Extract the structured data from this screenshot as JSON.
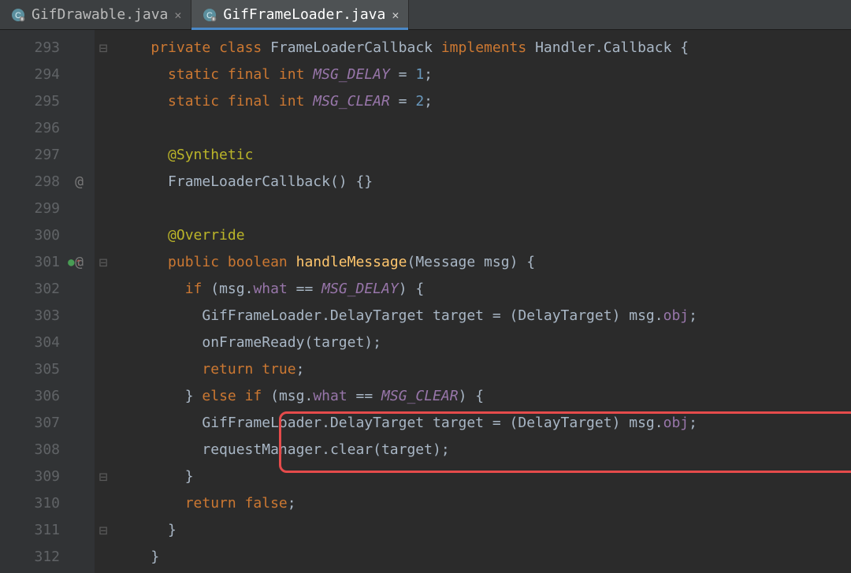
{
  "tabs": [
    {
      "label": "GifDrawable.java",
      "active": false
    },
    {
      "label": "GifFrameLoader.java",
      "active": true
    }
  ],
  "gutter": {
    "start": 293,
    "end": 312,
    "atMarks": {
      "298": "@",
      "301": "@"
    },
    "overrideMark": {
      "line": 301,
      "glyph": "O↑"
    }
  },
  "code": {
    "l293": {
      "kw_private": "private",
      "kw_class": "class",
      "class_name": "FrameLoaderCallback",
      "kw_implements": "implements",
      "iface": "Handler.Callback",
      "brace": " {"
    },
    "l294": {
      "kw": "static final int ",
      "name": "MSG_DELAY",
      "rest": " = ",
      "num": "1",
      "semi": ";"
    },
    "l295": {
      "kw": "static final int ",
      "name": "MSG_CLEAR",
      "rest": " = ",
      "num": "2",
      "semi": ";"
    },
    "l297": {
      "ann": "@Synthetic"
    },
    "l298": {
      "ctor": "FrameLoaderCallback",
      "rest": "() {}"
    },
    "l300": {
      "ann": "@Override"
    },
    "l301": {
      "kw_public": "public",
      "kw_boolean": "boolean",
      "method": "handleMessage",
      "params_open": "(",
      "param_type": "Message",
      "param_name": " msg",
      "params_close_brace": ") {"
    },
    "l302": {
      "kw_if": "if",
      "open": " (",
      "var": "msg",
      "dot": ".",
      "field": "what",
      "eq": " == ",
      "constref": "MSG_DELAY",
      "close": ") {"
    },
    "l303": {
      "type": "GifFrameLoader.DelayTarget",
      "var": " target = (",
      "cast": "DelayTarget",
      "rest": ") msg.",
      "field": "obj",
      "semi": ";"
    },
    "l304": {
      "call": "onFrameReady",
      "args": "(target);"
    },
    "l305": {
      "kw_return": "return",
      "kw_true": " true",
      "semi": ";"
    },
    "l306": {
      "close": "} ",
      "kw_else": "else",
      "kw_if": " if",
      "open": " (",
      "var": "msg",
      "dot": ".",
      "field": "what",
      "eq": " == ",
      "constref": "MSG_CLEAR",
      "close2": ") {"
    },
    "l307": {
      "type": "GifFrameLoader.DelayTarget",
      "var": " target = (",
      "cast": "DelayTarget",
      "rest": ") msg.",
      "field": "obj",
      "semi": ";"
    },
    "l308": {
      "recv": "requestManager",
      "dot": ".",
      "call": "clear",
      "args": "(target);"
    },
    "l309": {
      "brace": "}"
    },
    "l310": {
      "kw_return": "return",
      "kw_false": " false",
      "semi": ";"
    },
    "l311": {
      "brace": "}"
    },
    "l312": {
      "brace": "}"
    }
  }
}
